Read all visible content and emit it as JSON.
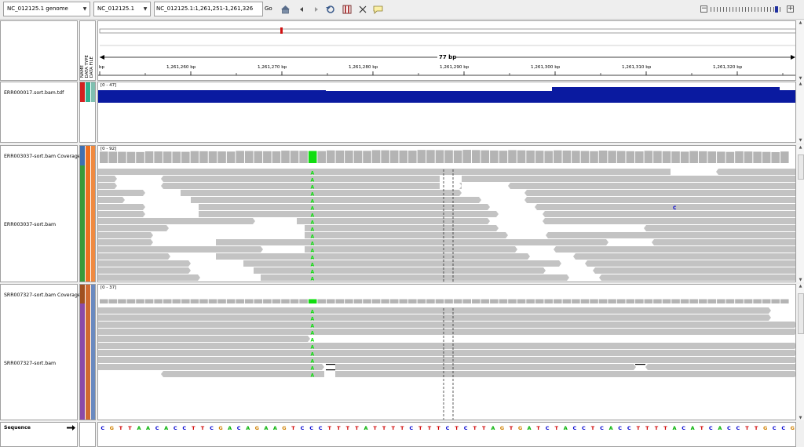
{
  "toolbar": {
    "genome": "NC_012125.1 genome",
    "chromosome": "NC_012125.1",
    "locus": "NC_012125.1:1,261,251-1,261,326",
    "go_label": "Go"
  },
  "header": {
    "attribute_labels": [
      "NAME",
      "DATA TYPE",
      "DATA FILE"
    ],
    "span_label": "77 bp",
    "ruler_ticks": [
      "bp",
      "1,261,260 bp",
      "1,261,270 bp",
      "1,261,280 bp",
      "1,261,290 bp",
      "1,261,300 bp",
      "1,261,310 bp",
      "1,261,320 bp"
    ]
  },
  "tracks": {
    "tdf": {
      "name": "ERR000017.sort.bam.tdf",
      "range": "[0 - 47]"
    },
    "err_coverage": {
      "name": "ERR003037-sort.bam Coverage",
      "range": "[0 - 92]"
    },
    "err_bam": {
      "name": "ERR003037-sort.bam",
      "mismatch_base": "A",
      "other_mismatch": "C"
    },
    "srr_coverage": {
      "name": "SRR007327-sort.bam Coverage",
      "range": "[0 - 37]"
    },
    "srr_bam": {
      "name": "SRR007327-sort.bam",
      "mismatch_base": "A"
    }
  },
  "sequence": {
    "label": "Sequence",
    "arrow_icon": "strand-arrow-icon",
    "bases": "CGTTAACACCTTCGACAGAAGTCCCTTTTATTTTCTTTCTCTTAGTGATCTACCTCACCTTTTACATCACCTTGCCG"
  },
  "colors": {
    "coverage_tdf": "#0a1aa0",
    "coverage_bam": "#b4b4b4",
    "read": "#c3c3c3",
    "mismatch": "#11dd11",
    "base_A": "#00b000",
    "base_C": "#0000d0",
    "base_G": "#d08000",
    "base_T": "#d00000"
  }
}
